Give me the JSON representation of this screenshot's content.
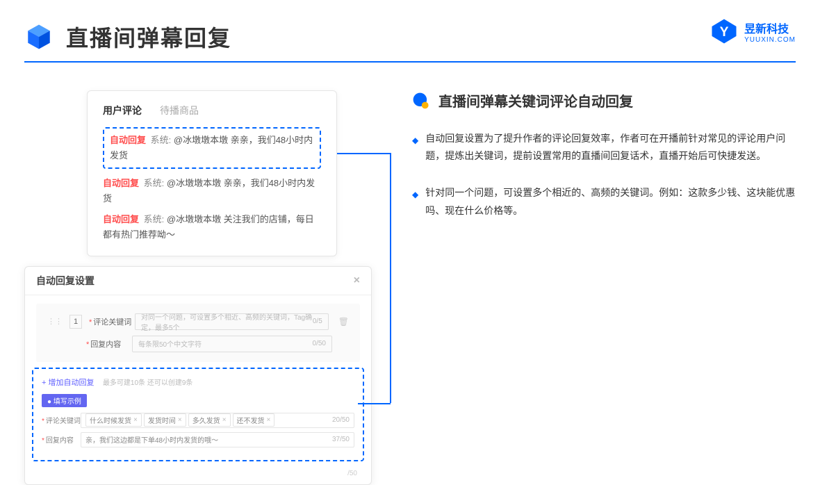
{
  "header": {
    "title": "直播间弹幕回复"
  },
  "brand": {
    "cn": "昱新科技",
    "en": "YUUXIN.COM"
  },
  "card1": {
    "tab_active": "用户评论",
    "tab_inactive": "待播商品",
    "line1_tag": "自动回复",
    "line1_sys": "系统:",
    "line1_text": "@冰墩墩本墩 亲亲，我们48小时内发货",
    "line2_tag": "自动回复",
    "line2_sys": "系统:",
    "line2_text": "@冰墩墩本墩 亲亲，我们48小时内发货",
    "line3_tag": "自动回复",
    "line3_sys": "系统:",
    "line3_text": "@冰墩墩本墩 关注我们的店铺，每日都有热门推荐呦～"
  },
  "card2": {
    "title": "自动回复设置",
    "row_num": "1",
    "label_keyword": "评论关键词",
    "placeholder_keyword": "对同一个问题，可设置多个相近、高频的关键词，Tag确定，最多5个",
    "counter_keyword": "0/5",
    "label_content": "回复内容",
    "placeholder_content": "每条限50个中文字符",
    "counter_content": "0/50",
    "add_link": "+ 增加自动回复",
    "add_hint": "最多可建10条 还可以创建9条",
    "badge": "● 填写示例",
    "ex_label_keyword": "评论关键词",
    "ex_tags": [
      "什么时候发货",
      "发货时间",
      "多久发货",
      "还不发货"
    ],
    "ex_counter_keyword": "20/50",
    "ex_label_content": "回复内容",
    "ex_content_text": "亲，我们这边都是下单48小时内发货的哦～",
    "ex_counter_content": "37/50",
    "outer_counter": "/50"
  },
  "right": {
    "title": "直播间弹幕关键词评论自动回复",
    "bullet1": "自动回复设置为了提升作者的评论回复效率，作者可在开播前针对常见的评论用户问题，提炼出关键词，提前设置常用的直播间回复话术，直播开始后可快捷发送。",
    "bullet2": "针对同一个问题，可设置多个相近的、高频的关键词。例如：这款多少钱、这块能优惠吗、现在什么价格等。"
  }
}
